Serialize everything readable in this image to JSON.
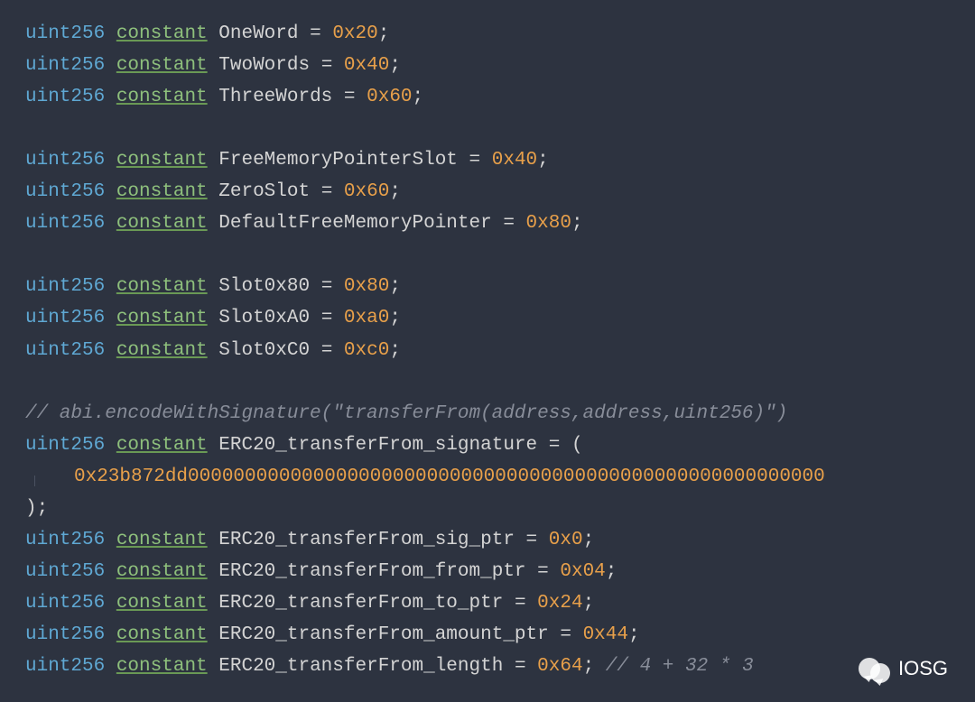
{
  "lines": [
    {
      "type": "uint256",
      "kw": "constant",
      "ident": "OneWord",
      "op": "=",
      "val": "0x20",
      "semi": ";"
    },
    {
      "type": "uint256",
      "kw": "constant",
      "ident": "TwoWords",
      "op": "=",
      "val": "0x40",
      "semi": ";"
    },
    {
      "type": "uint256",
      "kw": "constant",
      "ident": "ThreeWords",
      "op": "=",
      "val": "0x60",
      "semi": ";"
    },
    {
      "blank": true
    },
    {
      "type": "uint256",
      "kw": "constant",
      "ident": "FreeMemoryPointerSlot",
      "op": "=",
      "val": "0x40",
      "semi": ";"
    },
    {
      "type": "uint256",
      "kw": "constant",
      "ident": "ZeroSlot",
      "op": "=",
      "val": "0x60",
      "semi": ";"
    },
    {
      "type": "uint256",
      "kw": "constant",
      "ident": "DefaultFreeMemoryPointer",
      "op": "=",
      "val": "0x80",
      "semi": ";"
    },
    {
      "blank": true
    },
    {
      "type": "uint256",
      "kw": "constant",
      "ident": "Slot0x80",
      "op": "=",
      "val": "0x80",
      "semi": ";"
    },
    {
      "type": "uint256",
      "kw": "constant",
      "ident": "Slot0xA0",
      "op": "=",
      "val": "0xa0",
      "semi": ";"
    },
    {
      "type": "uint256",
      "kw": "constant",
      "ident": "Slot0xC0",
      "op": "=",
      "val": "0xc0",
      "semi": ";"
    },
    {
      "blank": true
    },
    {
      "comment": "// abi.encodeWithSignature(\"transferFrom(address,address,uint256)\")"
    },
    {
      "type": "uint256",
      "kw": "constant",
      "ident": "ERC20_transferFrom_signature",
      "op": "=",
      "paren": "("
    },
    {
      "indent": true,
      "val": "0x23b872dd00000000000000000000000000000000000000000000000000000000"
    },
    {
      "closeparen": ")",
      "semi": ";"
    },
    {
      "type": "uint256",
      "kw": "constant",
      "ident": "ERC20_transferFrom_sig_ptr",
      "op": "=",
      "val": "0x0",
      "semi": ";"
    },
    {
      "type": "uint256",
      "kw": "constant",
      "ident": "ERC20_transferFrom_from_ptr",
      "op": "=",
      "val": "0x04",
      "semi": ";"
    },
    {
      "type": "uint256",
      "kw": "constant",
      "ident": "ERC20_transferFrom_to_ptr",
      "op": "=",
      "val": "0x24",
      "semi": ";"
    },
    {
      "type": "uint256",
      "kw": "constant",
      "ident": "ERC20_transferFrom_amount_ptr",
      "op": "=",
      "val": "0x44",
      "semi": ";"
    },
    {
      "type": "uint256",
      "kw": "constant",
      "ident": "ERC20_transferFrom_length",
      "op": "=",
      "val": "0x64",
      "semi": ";",
      "trailcomment": " // 4 + 32 * 3 "
    }
  ],
  "watermark": {
    "label": "IOSG"
  }
}
